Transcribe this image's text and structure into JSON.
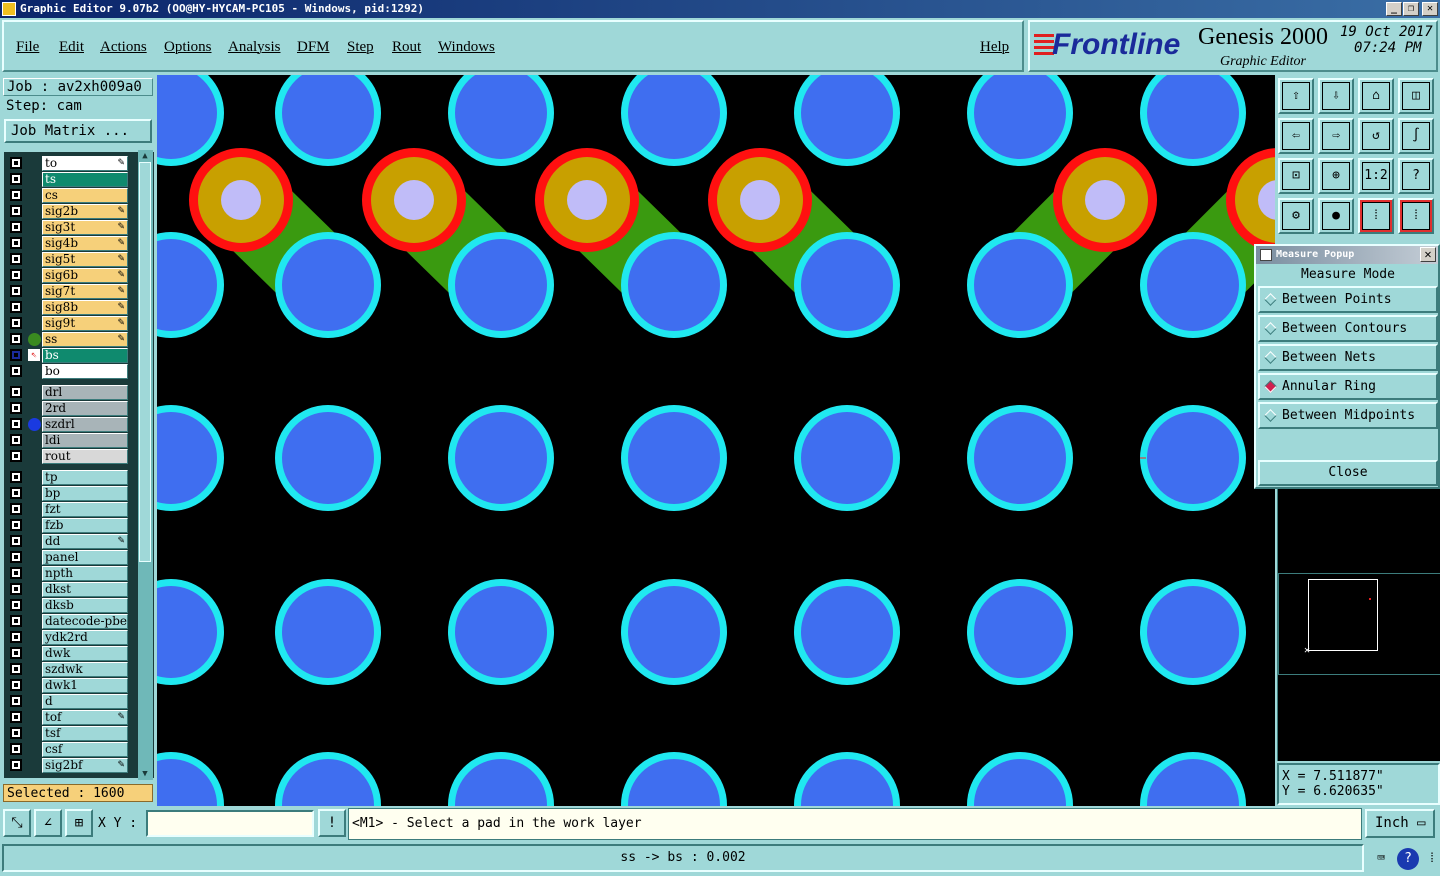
{
  "window": {
    "title": "Graphic Editor 9.07b2 (OO@HY-HYCAM-PC105 - Windows, pid:1292)",
    "minimize": "_",
    "maximize": "❐",
    "close": "✕"
  },
  "menu": {
    "file": "File",
    "edit": "Edit",
    "actions": "Actions",
    "options": "Options",
    "analysis": "Analysis",
    "dfm": "DFM",
    "step": "Step",
    "rout": "Rout",
    "windows": "Windows",
    "help": "Help"
  },
  "brand": {
    "logo": "Frontline",
    "product": "Genesis 2000",
    "subtitle": "Graphic Editor",
    "date": "19 Oct 2017",
    "time": "07:24 PM"
  },
  "job": {
    "job_text": "Job : av2xh009a0",
    "step_text": "Step: cam",
    "matrix_button": "Job Matrix ..."
  },
  "layers": [
    {
      "name": "to",
      "color": "#ffffff",
      "pen": true
    },
    {
      "name": "ts",
      "color": "#0f8a6e",
      "pen": false
    },
    {
      "name": "cs",
      "color": "#f6d07a",
      "pen": false
    },
    {
      "name": "sig2b",
      "color": "#f6d07a",
      "pen": true
    },
    {
      "name": "sig3t",
      "color": "#f6d07a",
      "pen": true
    },
    {
      "name": "sig4b",
      "color": "#f6d07a",
      "pen": true
    },
    {
      "name": "sig5t",
      "color": "#f6d07a",
      "pen": true
    },
    {
      "name": "sig6b",
      "color": "#f6d07a",
      "pen": true
    },
    {
      "name": "sig7t",
      "color": "#f6d07a",
      "pen": true
    },
    {
      "name": "sig8b",
      "color": "#f6d07a",
      "pen": true
    },
    {
      "name": "sig9t",
      "color": "#f6d07a",
      "pen": true
    },
    {
      "name": "ss",
      "color": "#f6d07a",
      "pen": true,
      "dot": "#3a8a20"
    },
    {
      "name": "bs",
      "color": "#0f8a6e",
      "pen": false,
      "work": true
    },
    {
      "name": "bo",
      "color": "#ffffff",
      "pen": false
    },
    {
      "name": "drl",
      "color": "#a8b4b8",
      "pen": false,
      "gap": true
    },
    {
      "name": "2rd",
      "color": "#a8b4b8",
      "pen": false
    },
    {
      "name": "szdrl",
      "color": "#a8b4b8",
      "pen": false,
      "dot": "#1a3ae0"
    },
    {
      "name": "ldi",
      "color": "#a8b4b8",
      "pen": false
    },
    {
      "name": "rout",
      "color": "#d8d8d8",
      "pen": false
    },
    {
      "name": "tp",
      "color": "#9fd8d8",
      "pen": false,
      "gap": true
    },
    {
      "name": "bp",
      "color": "#9fd8d8",
      "pen": false
    },
    {
      "name": "fzt",
      "color": "#9fd8d8",
      "pen": false
    },
    {
      "name": "fzb",
      "color": "#9fd8d8",
      "pen": false
    },
    {
      "name": "dd",
      "color": "#9fd8d8",
      "pen": true
    },
    {
      "name": "panel",
      "color": "#9fd8d8",
      "pen": false
    },
    {
      "name": "npth",
      "color": "#9fd8d8",
      "pen": false
    },
    {
      "name": "dkst",
      "color": "#9fd8d8",
      "pen": false
    },
    {
      "name": "dksb",
      "color": "#9fd8d8",
      "pen": false
    },
    {
      "name": "datecode-pbe",
      "color": "#9fd8d8",
      "pen": false
    },
    {
      "name": "ydk2rd",
      "color": "#9fd8d8",
      "pen": false
    },
    {
      "name": "dwk",
      "color": "#9fd8d8",
      "pen": false
    },
    {
      "name": "szdwk",
      "color": "#9fd8d8",
      "pen": false
    },
    {
      "name": "dwk1",
      "color": "#9fd8d8",
      "pen": false
    },
    {
      "name": "d",
      "color": "#9fd8d8",
      "pen": false
    },
    {
      "name": "tof",
      "color": "#9fd8d8",
      "pen": true
    },
    {
      "name": "tsf",
      "color": "#9fd8d8",
      "pen": false
    },
    {
      "name": "csf",
      "color": "#9fd8d8",
      "pen": false
    },
    {
      "name": "sig2bf",
      "color": "#9fd8d8",
      "pen": true
    }
  ],
  "selected": "Selected : 1600",
  "measure_popup": {
    "title": "Measure Popup",
    "mode_label": "Measure Mode",
    "options": [
      "Between Points",
      "Between Contours",
      "Between Nets",
      "Annular Ring",
      "Between Midpoints"
    ],
    "selected_option": "Annular Ring",
    "close": "Close"
  },
  "coordinates": {
    "x": "X = 7.511877\"",
    "y": "Y = 6.620635\""
  },
  "bottom": {
    "xy_label": "X Y :",
    "xy_value": "",
    "message": "<M1> - Select a pad in the work layer",
    "unit": "Inch",
    "status": "ss -> bs : 0.002"
  },
  "colors": {
    "background": "#000000",
    "pad_ring": "#20e8f0",
    "pad_fill": "#3f6ef0",
    "ss_pad_red": "#ff1010",
    "ss_pad_gold": "#c8a000",
    "ss_center": "#c0bcf8",
    "ss_trace": "#3a9a10"
  }
}
